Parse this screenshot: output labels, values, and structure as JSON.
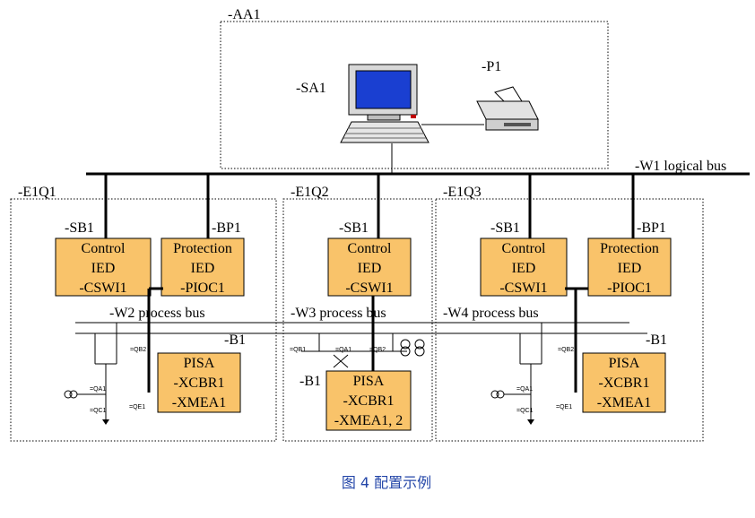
{
  "areas": {
    "aa1": "-AA1",
    "e1q1": "-E1Q1",
    "e1q2": "-E1Q2",
    "e1q3": "-E1Q3"
  },
  "devices": {
    "sa1": "-SA1",
    "p1": "-P1"
  },
  "buses": {
    "w1": "-W1 logical bus",
    "w2": "-W2 process bus",
    "w3": "-W3 process bus",
    "w4": "-W4 process bus"
  },
  "bay_labels": {
    "sb1": "-SB1",
    "bp1": "-BP1",
    "b1": "-B1"
  },
  "ieds": {
    "control": [
      "Control",
      "IED",
      "-CSWI1"
    ],
    "protection": [
      "Protection",
      "IED",
      "-PIOC1"
    ],
    "pisa_side": [
      "PISA",
      "-XCBR1",
      "-XMEA1"
    ],
    "pisa_mid": [
      "PISA",
      "-XCBR1",
      "-XMEA1, 2"
    ]
  },
  "switch_labels": {
    "qb2": "=QB2",
    "qa1": "=QA1",
    "qc1": "=QC1",
    "qe1": "=QE1",
    "qb1": "=QB1"
  },
  "caption": "图 4 配置示例",
  "colors": {
    "ied_fill": "#f9c36a",
    "caption": "#2446a8",
    "monitor_screen": "#1a3fd1"
  }
}
